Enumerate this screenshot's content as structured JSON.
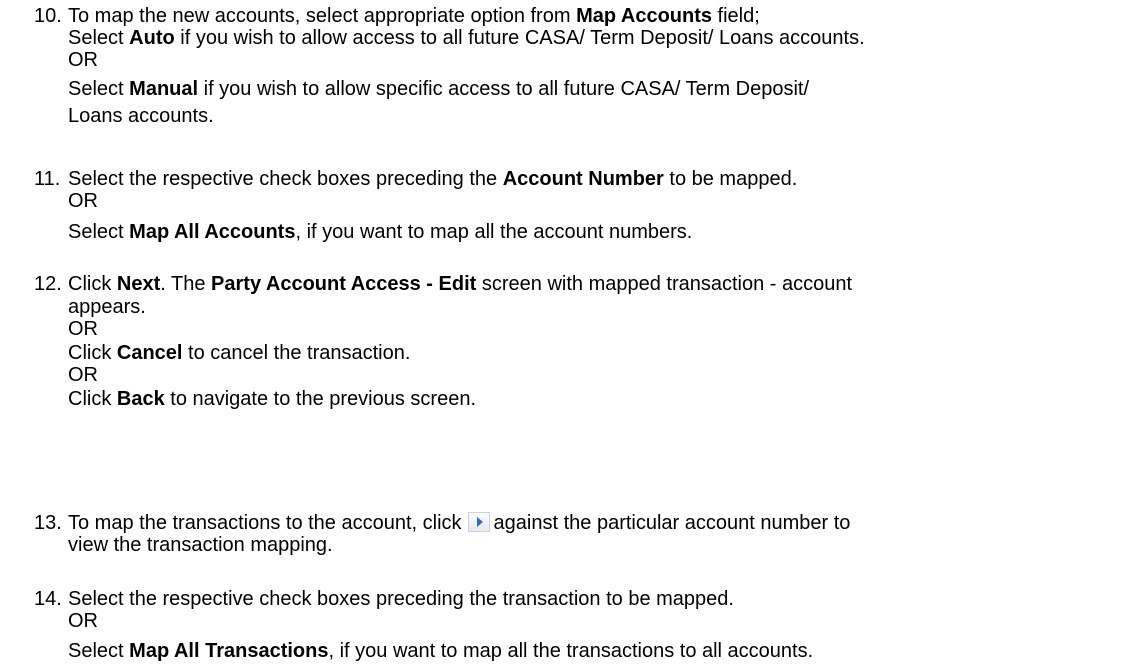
{
  "steps": [
    {
      "number": "10.",
      "lines": [
        {
          "t1": "To map the new accounts, select appropriate option from ",
          "b1": "Map Accounts",
          "t2": " field;"
        },
        {
          "t1": "Select ",
          "b1": "Auto",
          "t2": " if you wish to allow access to all future CASA/ Term Deposit/ Loans accounts."
        },
        {
          "t1": "OR"
        },
        {
          "t1": "Select ",
          "b1": "Manual",
          "t2": " if you wish to allow specific access to all future CASA/ Term Deposit/"
        },
        {
          "t1": "Loans accounts."
        }
      ]
    },
    {
      "number": "11.",
      "lines": [
        {
          "t1": "Select the respective check boxes preceding the ",
          "b1": "Account Number",
          "t2": " to be mapped."
        },
        {
          "t1": "OR"
        },
        {
          "t1": "Select ",
          "b1": "Map All Accounts",
          "t2": ", if you want to map all the account numbers."
        }
      ]
    },
    {
      "number": "12.",
      "lines": [
        {
          "t1": "Click ",
          "b1": "Next",
          "t2": ". The ",
          "b2": "Party Account Access - Edit",
          "t3": " screen with mapped transaction - account"
        },
        {
          "t1": "appears."
        },
        {
          "t1": "OR"
        },
        {
          "t1": "Click ",
          "b1": "Cancel",
          "t2": " to cancel the transaction."
        },
        {
          "t1": "OR"
        },
        {
          "t1": "Click ",
          "b1": "Back",
          "t2": " to navigate to the previous screen."
        }
      ]
    },
    {
      "number": "13.",
      "lines": [
        {
          "t1": "To map the transactions to the account, click",
          "t2": "against the particular account number to"
        },
        {
          "t1": "view the transaction mapping."
        }
      ]
    },
    {
      "number": "14.",
      "lines": [
        {
          "t1": "Select the respective check boxes preceding the transaction to be mapped."
        },
        {
          "t1": "OR"
        },
        {
          "t1": "Select ",
          "b1": "Map All Transactions",
          "t2": ", if you want to map all the transactions to all accounts."
        }
      ]
    }
  ],
  "icons": {
    "expand": "play-arrow-icon"
  }
}
